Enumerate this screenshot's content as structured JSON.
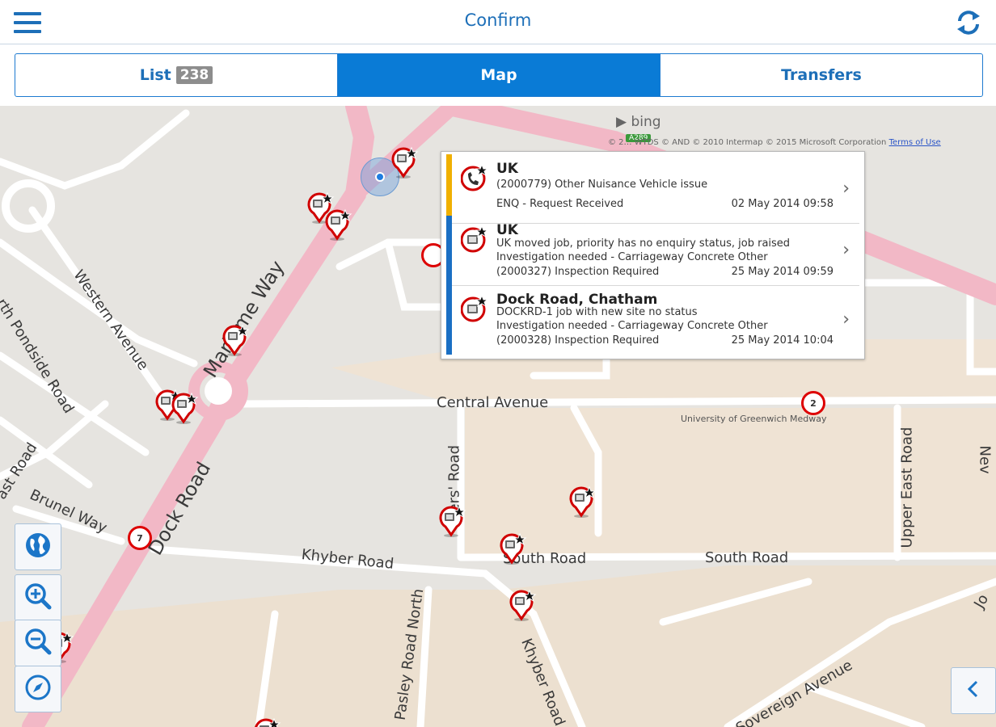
{
  "header": {
    "title": "Confirm",
    "menu_icon": "hamburger-menu-icon",
    "refresh_icon": "refresh-icon"
  },
  "tabs": [
    {
      "label": "List",
      "badge": "238",
      "active": false
    },
    {
      "label": "Map",
      "active": true
    },
    {
      "label": "Transfers",
      "active": false
    }
  ],
  "map": {
    "attribution": {
      "brand": "bing",
      "road_sign": "A289",
      "copyright": "© 2… WTDS © AND © 2010 Intermap © 2015 Microsoft Corporation",
      "terms_link": "Terms of Use"
    },
    "labels": {
      "western_avenue": "Western Avenue",
      "maritime_way": "Maritime Way",
      "north_pondside": "rth Pondside Road",
      "east_road": "ast Road",
      "brunel_way": "Brunel Way",
      "dock_road": "Dock Road",
      "central_avenue": "Central Avenue",
      "university": "University of Greenwich Medway",
      "upper_east_road": "Upper East Road",
      "new": "Nev",
      "officers_road": "icers' Road",
      "khyber_road": "Khyber Road",
      "khyber_road_2": "Khyber Road",
      "south_road": "South Road",
      "south_road_2": "South Road",
      "pasley_road_north": "Pasley Road North",
      "sovereign_avenue": "Sovereign Avenue",
      "jo": "Jo"
    },
    "clusters": [
      {
        "count": "2"
      },
      {
        "count": "7"
      }
    ],
    "controls": {
      "globe_icon": "globe-icon",
      "zoom_in_icon": "zoom-in-icon",
      "zoom_out_icon": "zoom-out-icon",
      "compass_icon": "compass-icon",
      "side_panel_icon": "chevron-left-icon"
    }
  },
  "popup": {
    "items": [
      {
        "title": "UK",
        "line1": "(2000779) Other Nuisance Vehicle issue",
        "line2": "ENQ - Request Received",
        "date": "02 May 2014 09:58",
        "status_color": "#f0b000",
        "icon": "phone-enquiry-icon"
      },
      {
        "title": "UK",
        "line1": "UK moved job, priority has no enquiry status, job raised",
        "line2": "Investigation needed - Carriageway Concrete Other",
        "line3": "(2000327) Inspection Required",
        "date": "25 May 2014 09:59",
        "status_color": "#1a6fc4",
        "icon": "job-icon"
      },
      {
        "title": "Dock Road, Chatham",
        "line1": "DOCKRD-1 job with new site no status",
        "line2": "Investigation needed - Carriageway Concrete Other",
        "line3": "(2000328) Inspection Required",
        "date": "25 May 2014 10:04",
        "status_color": "#1a6fc4",
        "icon": "job-icon"
      }
    ]
  },
  "colors": {
    "accent": "#0a7bd6",
    "header_text": "#1d6fb8",
    "pin_red": "#d00000",
    "road_pink": "#f2b8c6",
    "map_bg": "#e6e4e0",
    "building": "#efe3d4"
  }
}
